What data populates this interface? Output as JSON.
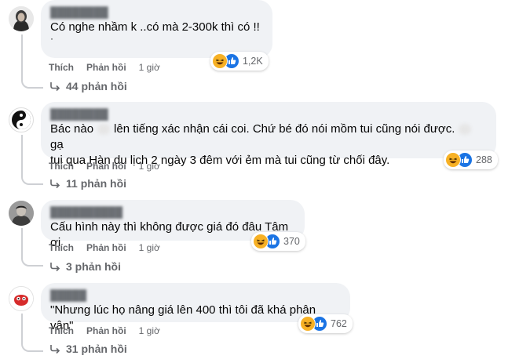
{
  "comments": [
    {
      "text_line1": "Có nghe nhầm k ..có mà 2-300k thì có !!",
      "text_line2": "·",
      "like": "Thích",
      "reply": "Phản hồi",
      "time": "1 giờ",
      "reaction_count": "1,2K",
      "replies_label": "44 phản hồi"
    },
    {
      "text_line1a": "Bác nào",
      "text_line1b": "lên tiếng xác nhận cái coi. Chứ bé đó nói mồm tui cũng nói được.",
      "text_line1c": "gạ",
      "text_line2": "tui qua Hàn du lịch 2 ngày 3 đêm với ẻm mà tui cũng từ chối đây.",
      "like": "Thích",
      "reply": "Phản hồi",
      "time": "1 giờ",
      "reaction_count": "288",
      "replies_label": "11 phản hồi"
    },
    {
      "text_line1": "Cấu hình này thì không được giá đó đâu Tâm ơi",
      "like": "Thích",
      "reply": "Phản hồi",
      "time": "1 giờ",
      "reaction_count": "370",
      "replies_label": "3 phản hồi"
    },
    {
      "text_line1": "\"Nhưng lúc họ nâng giá lên 400 thì tôi đã khá phân vân\"",
      "like": "Thích",
      "reply": "Phản hồi",
      "time": "1 giờ",
      "reaction_count": "762",
      "replies_label": "31 phản hồi"
    }
  ],
  "icons": {
    "reaction_primary": "haha-icon",
    "reaction_secondary": "like-icon",
    "reply_arrow": "reply-arrow-icon"
  },
  "colors": {
    "bubble": "#f0f2f5",
    "meta_text": "#65676b",
    "like_blue": "#1b74e4",
    "haha_yellow": "#f7b125"
  }
}
